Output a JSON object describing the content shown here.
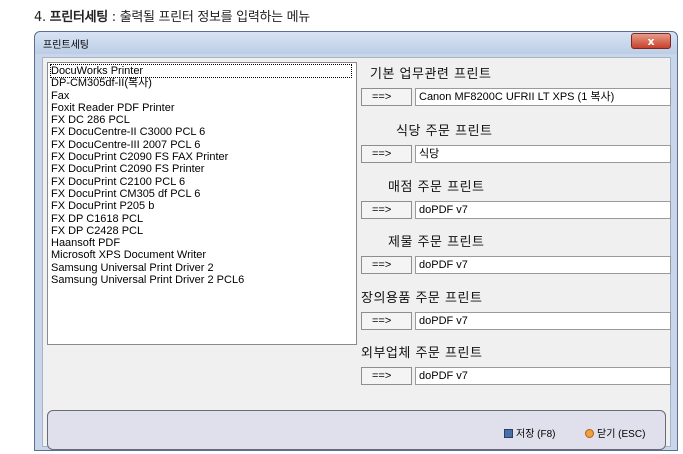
{
  "caption": {
    "num": "4.",
    "title": "프린터세팅",
    "sep": " : ",
    "desc": "출력될 프린터 정보를 입력하는 메뉴"
  },
  "window": {
    "title": "프린트세팅",
    "close_label": "x"
  },
  "printer_list": [
    "DocuWorks Printer",
    "DP-CM305df-II(복사)",
    "Fax",
    "Foxit Reader PDF Printer",
    "FX DC 286 PCL",
    "FX DocuCentre-II C3000 PCL 6",
    "FX DocuCentre-III 2007 PCL 6",
    "FX DocuPrint C2090 FS FAX Printer",
    "FX DocuPrint C2090 FS Printer",
    "FX DocuPrint C2100 PCL 6",
    "FX DocuPrint CM305 df PCL 6",
    "FX DocuPrint P205 b",
    "FX DP C1618 PCL",
    "FX DP C2428 PCL",
    "Haansoft PDF",
    "Microsoft XPS Document Writer",
    "Samsung Universal Print Driver 2",
    "Samsung Universal Print Driver 2 PCL6"
  ],
  "assign_button_label": "==>",
  "sections": [
    {
      "label": "기본 업무관련 프린트",
      "value": "Canon MF8200C UFRII LT XPS (1 복사)"
    },
    {
      "label": "식당 주문 프린트",
      "value": "식당"
    },
    {
      "label": "매점 주문 프린트",
      "value": "doPDF v7"
    },
    {
      "label": "제물 주문 프린트",
      "value": "doPDF v7"
    },
    {
      "label": "장의용품 주문 프린트",
      "value": "doPDF v7"
    },
    {
      "label": "외부업체 주문 프린트",
      "value": "doPDF v7"
    }
  ],
  "footer": {
    "save_label": "저장 (F8)",
    "close_label": "닫기 (ESC)"
  }
}
